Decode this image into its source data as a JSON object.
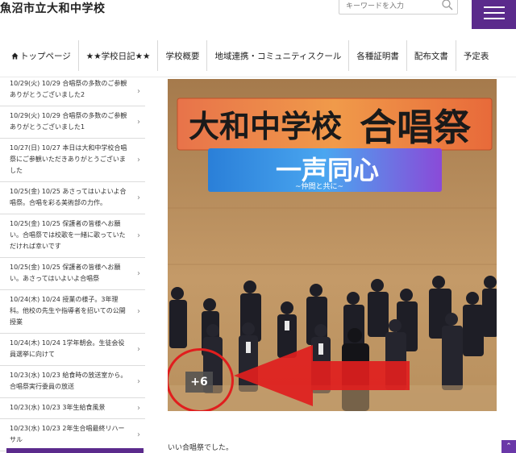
{
  "header": {
    "site_title": "魚沼市立大和中学校",
    "search_placeholder": "キーワードを入力",
    "search_icon": "search-icon",
    "menu_icon": "hamburger-menu-icon",
    "accent_color": "#5b2a8c"
  },
  "nav": {
    "items": [
      {
        "label": "トップページ",
        "icon": "home-icon"
      },
      {
        "label": "★★学校日記★★"
      },
      {
        "label": "学校概要"
      },
      {
        "label": "地域連携・コミュニティスクール"
      },
      {
        "label": "各種証明書"
      },
      {
        "label": "配布文書"
      },
      {
        "label": "予定表"
      }
    ]
  },
  "sidebar": {
    "items": [
      {
        "label": "10/29(火) 10/29 合唱祭の多数のご参観ありがとうございました2"
      },
      {
        "label": "10/29(火) 10/29 合唱祭の多数のご参観ありがとうございました1"
      },
      {
        "label": "10/27(日) 10/27 本日は大和中学校合唱祭にご参観いただきありがとうございました"
      },
      {
        "label": "10/25(金) 10/25 あさってはいよいよ合唱祭。合唱を彩る美術部の力作。"
      },
      {
        "label": "10/25(金) 10/25 保護者の皆様へお願い。合唱祭では校歌を一緒に歌っていただければ幸いです"
      },
      {
        "label": "10/25(金) 10/25 保護者の皆様へお願い。あさってはいよいよ合唱祭"
      },
      {
        "label": "10/24(木) 10/24 授業の様子。3年理科。他校の先生や指導者を招いての公開授業"
      },
      {
        "label": "10/24(木) 10/24 1学年朝会。生徒会役員選挙に向けて"
      },
      {
        "label": "10/23(水) 10/23 給食時の放送室から。合唱祭実行委員の放送"
      },
      {
        "label": "10/23(水) 10/23 3年生給食風景"
      },
      {
        "label": "10/23(水) 10/23 2年生合唱最終リハーサル"
      }
    ]
  },
  "photo": {
    "banner_school": "大和中学校",
    "banner_event": "合唱祭",
    "banner_slogan": "一声同心",
    "banner_sub": "~仲間と共に~",
    "more_count": "+6"
  },
  "main": {
    "caption": "いい合唱祭でした。"
  }
}
